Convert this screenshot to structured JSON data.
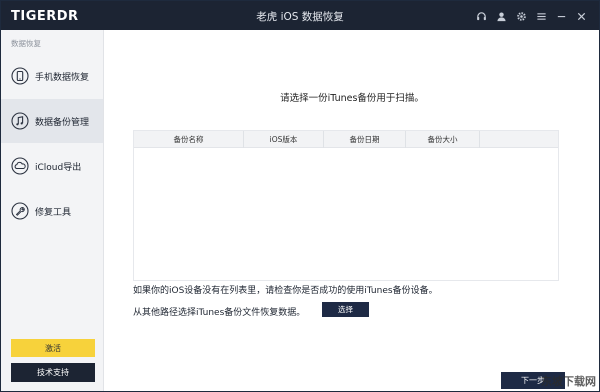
{
  "app": {
    "logo": "TIGERDR",
    "window_title": "老虎 iOS 数据恢复"
  },
  "titlebar_icons": [
    "headset-icon",
    "user-icon",
    "gear-icon",
    "menu-icon",
    "minimize-icon",
    "close-icon"
  ],
  "sidebar": {
    "caption": "数据恢复",
    "items": [
      {
        "label": "手机数据恢复",
        "icon": "phone-icon",
        "active": false
      },
      {
        "label": "数据备份管理",
        "icon": "music-icon",
        "active": true
      },
      {
        "label": "iCloud导出",
        "icon": "cloud-icon",
        "active": false
      },
      {
        "label": "修复工具",
        "icon": "wrench-icon",
        "active": false
      }
    ],
    "activate_label": "激活",
    "support_label": "技术支持"
  },
  "main": {
    "prompt": "请选择一份iTunes备份用于扫描。",
    "table_headers": [
      "备份名称",
      "iOS版本",
      "备份日期",
      "备份大小"
    ],
    "rows": [],
    "info_line1": "如果你的iOS设备没有在列表里，请检查你是否成功的使用iTunes备份设备。",
    "info_line2": "从其他路径选择iTunes备份文件恢复数据。",
    "select_label": "选择",
    "next_label": "下一步"
  },
  "watermark": "东坡下载网",
  "colors": {
    "titlebar": "#1c2433",
    "accent_dark": "#1e2a45",
    "activate": "#f7d23b",
    "sidebar_bg": "#f3f4f6"
  }
}
